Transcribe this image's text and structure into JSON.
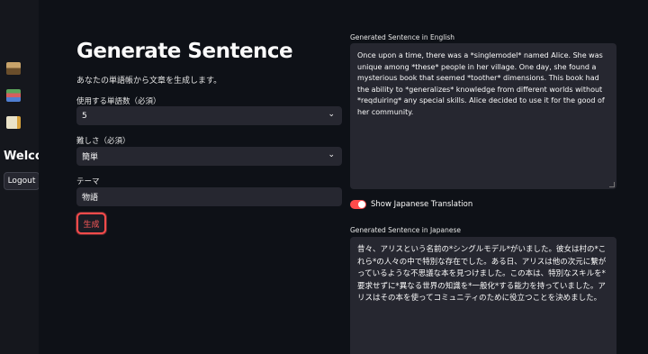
{
  "sidebar": {
    "icons": [
      "picture-icon",
      "books-icon",
      "memo-icon"
    ],
    "welcome": "Welcome",
    "logout_label": "Logout"
  },
  "main": {
    "title": "Generate Sentence",
    "subtitle": "あなたの単語帳から文章を生成します。",
    "word_count": {
      "label": "使用する単語数（必須）",
      "value": "5"
    },
    "difficulty": {
      "label": "難しさ（必須）",
      "value": "簡単"
    },
    "theme": {
      "label": "テーマ",
      "value": "物語"
    },
    "generate_label": "生成"
  },
  "output": {
    "english_label": "Generated Sentence in English",
    "english_text": "Once upon a time, there was a *singlemodel* named Alice. She was unique among *these* people in her village. One day, she found a mysterious book that seemed *toother* dimensions. This book had the ability to *generalizes* knowledge from different worlds without *reqduiring* any special skills. Alice decided to use it for the good of her community.",
    "toggle_label": "Show Japanese Translation",
    "toggle_on": true,
    "japanese_label": "Generated Sentence in Japanese",
    "japanese_text": "昔々、アリスという名前の*シングルモデル*がいました。彼女は村の*これら*の人々の中で特別な存在でした。ある日、アリスは他の次元に繋がっているような不思議な本を見つけました。この本は、特別なスキルを*要求せずに*異なる世界の知識を*一般化*する能力を持っていました。アリスはその本を使ってコミュニティのために役立つことを決めました。"
  },
  "colors": {
    "accent": "#ff4b4b",
    "background": "#0e1117",
    "input_bg": "#262730"
  }
}
